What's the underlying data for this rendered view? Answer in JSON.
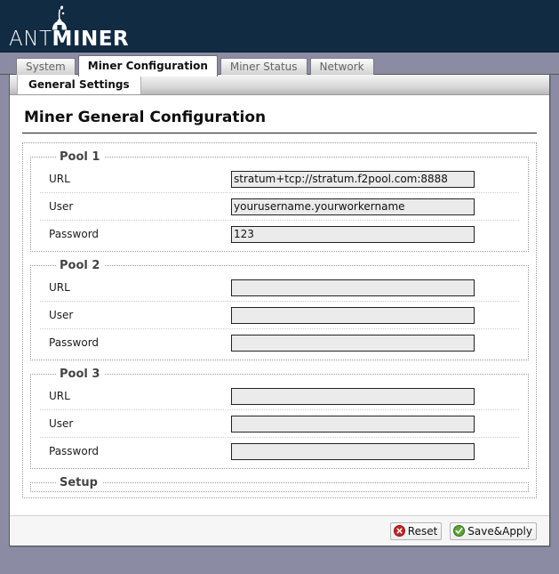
{
  "header": {
    "logo_text_light": "ANT",
    "logo_text_bold": "MINER",
    "logo_icon": "ant-icon",
    "background_color": "#112b42"
  },
  "tabbar": {
    "tabs": [
      {
        "label": "System",
        "active": false
      },
      {
        "label": "Miner Configuration",
        "active": true
      },
      {
        "label": "Miner Status",
        "active": false
      },
      {
        "label": "Network",
        "active": false
      }
    ],
    "background_color": "#8b8ba3"
  },
  "subtabbar": {
    "tabs": [
      {
        "label": "General Settings",
        "active": true
      }
    ]
  },
  "main": {
    "page_title": "Miner General Configuration",
    "pools": [
      {
        "legend": "Pool 1",
        "fields": [
          {
            "label": "URL",
            "value": "stratum+tcp://stratum.f2pool.com:8888",
            "placeholder": ""
          },
          {
            "label": "User",
            "value": "yourusername.yourworkername",
            "placeholder": ""
          },
          {
            "label": "Password",
            "value": "123",
            "placeholder": ""
          }
        ]
      },
      {
        "legend": "Pool 2",
        "fields": [
          {
            "label": "URL",
            "value": "",
            "placeholder": ""
          },
          {
            "label": "User",
            "value": "",
            "placeholder": ""
          },
          {
            "label": "Password",
            "value": "",
            "placeholder": ""
          }
        ]
      },
      {
        "legend": "Pool 3",
        "fields": [
          {
            "label": "URL",
            "value": "",
            "placeholder": ""
          },
          {
            "label": "User",
            "value": "",
            "placeholder": ""
          },
          {
            "label": "Password",
            "value": "",
            "placeholder": ""
          }
        ]
      }
    ],
    "setup": {
      "legend": "Setup"
    }
  },
  "footer": {
    "buttons": [
      {
        "label": "Reset",
        "icon": "red-cross-circle-icon",
        "icon_color": "#cc2222"
      },
      {
        "label": "Save&Apply",
        "icon": "green-check-circle-icon",
        "icon_color": "#5aa832"
      }
    ]
  }
}
